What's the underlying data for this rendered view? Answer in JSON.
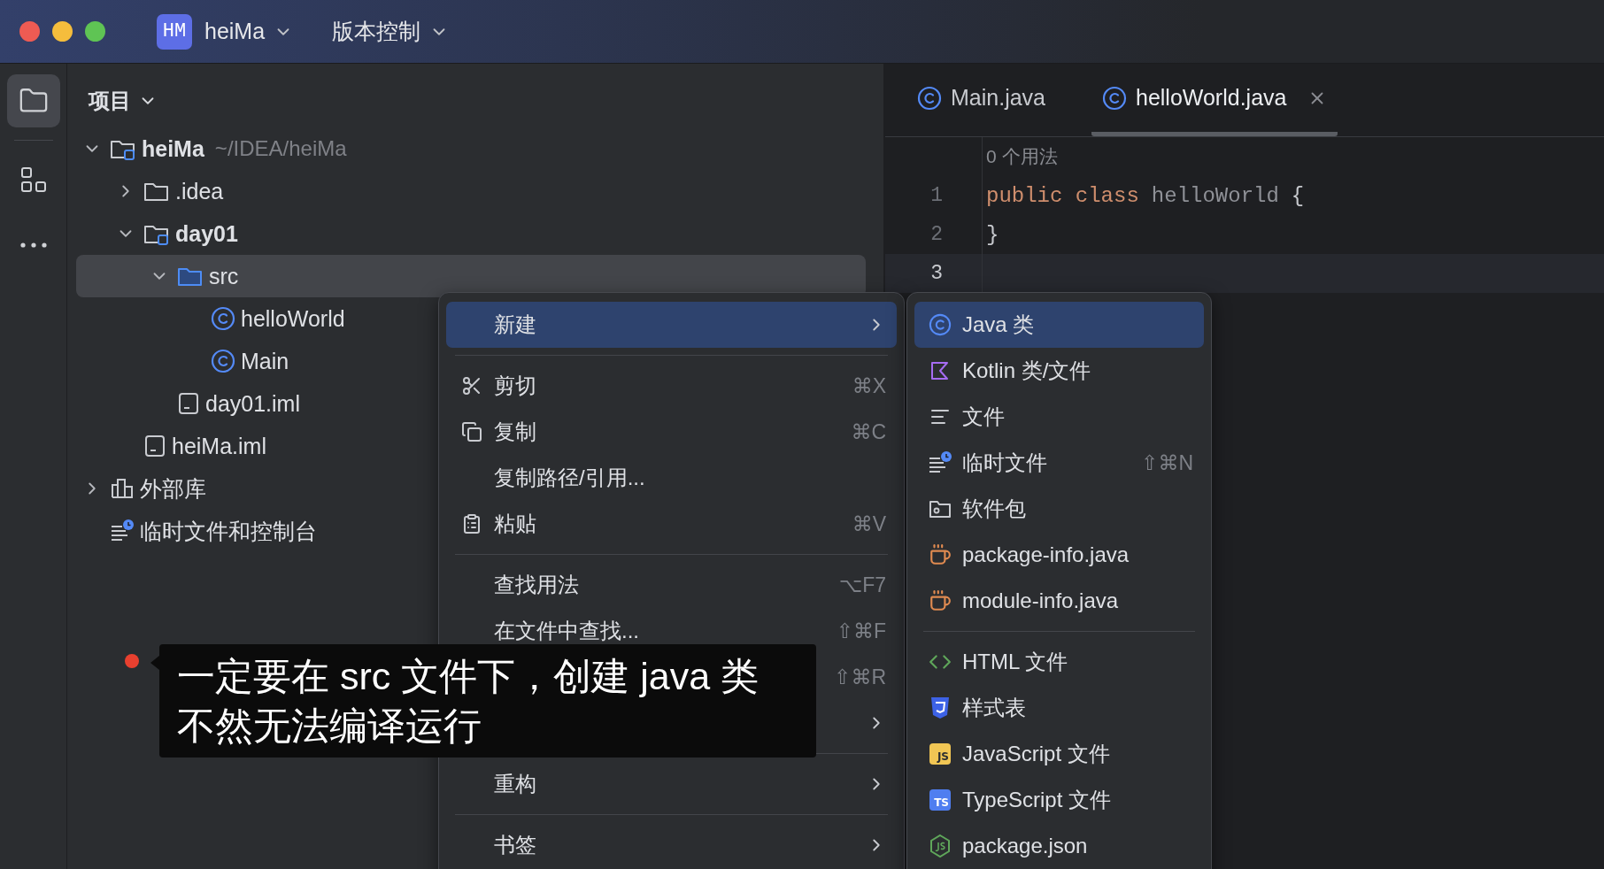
{
  "title_bar": {
    "project": {
      "badge": "HM",
      "name": "heiMa"
    },
    "vcs": "版本控制"
  },
  "tool_strip": [
    {
      "kind": "folder",
      "selected": true
    },
    {
      "kind": "structure",
      "selected": false
    },
    {
      "kind": "more",
      "selected": false
    }
  ],
  "project_panel": {
    "title": "项目",
    "tree": [
      {
        "kind": "module",
        "label": "heiMa",
        "hint": "~/IDEA/heiMa",
        "expanded": true,
        "selected": false,
        "children": [
          {
            "kind": "folder",
            "label": ".idea",
            "expanded": false,
            "selected": false
          },
          {
            "kind": "module",
            "label": "day01",
            "expanded": true,
            "selected": false,
            "children": [
              {
                "kind": "source-folder",
                "label": "src",
                "expanded": true,
                "selected": true,
                "children": [
                  {
                    "kind": "class",
                    "label": "helloWorld",
                    "selected": false
                  },
                  {
                    "kind": "class",
                    "label": "Main",
                    "selected": false
                  }
                ]
              },
              {
                "kind": "module-file",
                "label": "day01.iml",
                "selected": false
              }
            ]
          },
          {
            "kind": "module-file",
            "label": "heiMa.iml",
            "selected": false
          }
        ]
      },
      {
        "kind": "library",
        "label": "外部库",
        "expanded": false,
        "selected": false
      },
      {
        "kind": "scratch",
        "label": "临时文件和控制台",
        "selected": false
      }
    ]
  },
  "editor": {
    "tabs": [
      {
        "label": "Main.java",
        "selected": false,
        "closable": false
      },
      {
        "label": "helloWorld.java",
        "selected": true,
        "closable": true
      }
    ],
    "usage_hint": "0 个用法",
    "lines": [
      {
        "number": "1",
        "current": false,
        "tokens": [
          {
            "kind": "keyword",
            "text": "public class"
          },
          {
            "kind": "unused",
            "text": "helloWorld"
          },
          {
            "kind": "plain",
            "text": "{"
          }
        ]
      },
      {
        "number": "2",
        "current": false,
        "tokens": [
          {
            "kind": "plain",
            "text": "}"
          }
        ]
      },
      {
        "number": "3",
        "current": true
      }
    ]
  },
  "context_menu": {
    "items": [
      {
        "kind": "entry",
        "label": "新建",
        "submenu": true,
        "selected": true
      },
      {
        "kind": "separator"
      },
      {
        "kind": "cut",
        "label": "剪切",
        "shortcut": "⌘X",
        "selected": false
      },
      {
        "kind": "copy",
        "label": "复制",
        "shortcut": "⌘C",
        "selected": false
      },
      {
        "kind": "entry",
        "label": "复制路径/引用...",
        "selected": false
      },
      {
        "kind": "paste",
        "label": "粘贴",
        "shortcut": "⌘V",
        "selected": false
      },
      {
        "kind": "separator"
      },
      {
        "kind": "entry",
        "label": "查找用法",
        "shortcut": "⌥F7",
        "selected": false
      },
      {
        "kind": "entry",
        "label": "在文件中查找...",
        "shortcut": "⇧⌘F",
        "selected": false
      },
      {
        "kind": "entry",
        "shortcut": "⇧⌘R",
        "selected": false
      },
      {
        "kind": "entry",
        "submenu": true,
        "selected": false
      },
      {
        "kind": "separator"
      },
      {
        "kind": "entry",
        "label": "重构",
        "submenu": true,
        "selected": false
      },
      {
        "kind": "separator"
      },
      {
        "kind": "entry",
        "label": "书签",
        "submenu": true,
        "selected": false
      }
    ]
  },
  "new_submenu": {
    "items": [
      {
        "kind": "java-class",
        "label": "Java 类",
        "selected": true
      },
      {
        "kind": "kotlin",
        "label": "Kotlin 类/文件",
        "selected": false
      },
      {
        "kind": "file",
        "label": "文件",
        "selected": false
      },
      {
        "kind": "scratch",
        "label": "临时文件",
        "shortcut": "⇧⌘N",
        "selected": false
      },
      {
        "kind": "package",
        "label": "软件包",
        "selected": false
      },
      {
        "kind": "package-info",
        "label": "package-info.java",
        "selected": false
      },
      {
        "kind": "module-info",
        "label": "module-info.java",
        "selected": false
      },
      {
        "kind": "separator"
      },
      {
        "kind": "html",
        "label": "HTML 文件",
        "selected": false
      },
      {
        "kind": "css",
        "label": "样式表",
        "selected": false
      },
      {
        "kind": "js",
        "badge": "JS",
        "label": "JavaScript 文件",
        "selected": false
      },
      {
        "kind": "ts",
        "badge": "TS",
        "label": "TypeScript 文件",
        "selected": false
      },
      {
        "kind": "npm",
        "label": "package.json",
        "selected": false
      }
    ]
  },
  "caption": {
    "lines": [
      "一定要在 src 文件下，创建 java 类",
      "不然无法编译运行"
    ]
  }
}
